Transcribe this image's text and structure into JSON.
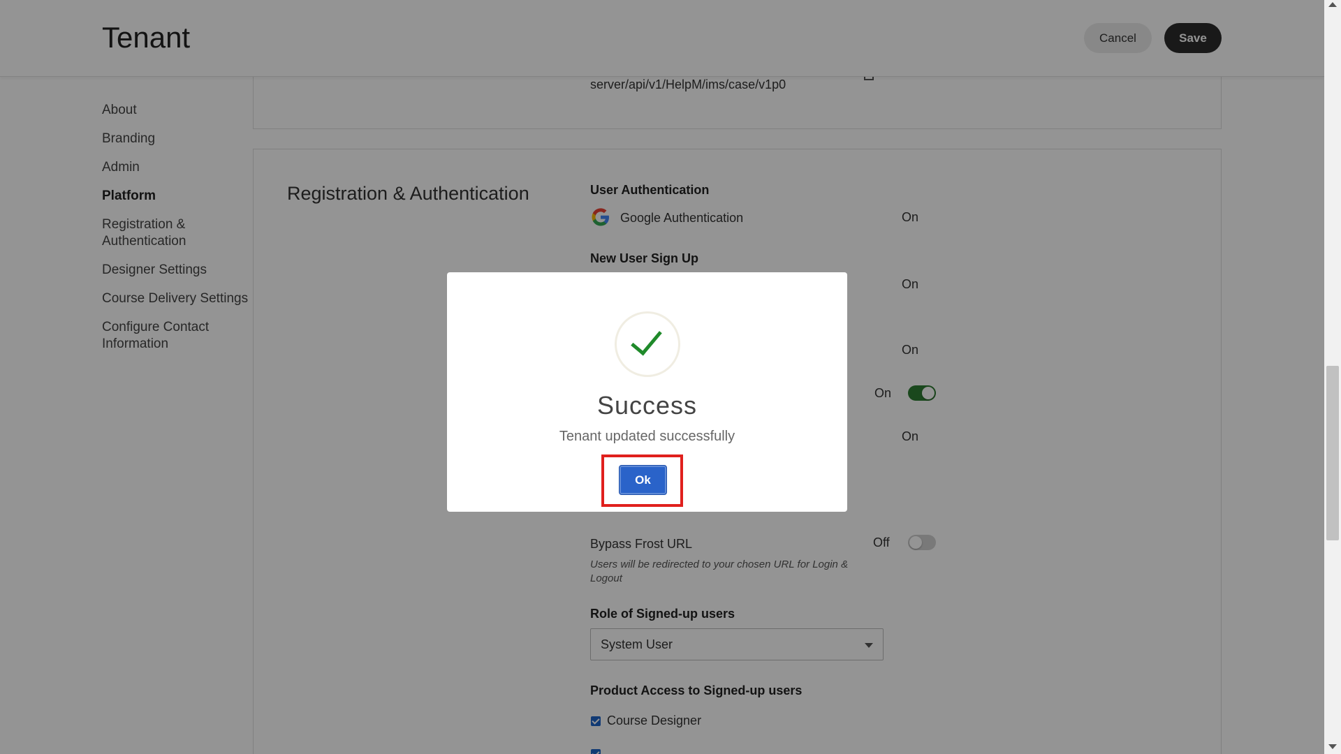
{
  "header": {
    "title": "Tenant",
    "cancel_label": "Cancel",
    "save_label": "Save"
  },
  "nav": {
    "items": [
      {
        "label": "About"
      },
      {
        "label": "Branding"
      },
      {
        "label": "Admin"
      },
      {
        "label": "Platform"
      },
      {
        "label": "Registration & Authentication"
      },
      {
        "label": "Designer Settings"
      },
      {
        "label": "Course Delivery Settings"
      },
      {
        "label": "Configure Contact Information"
      }
    ]
  },
  "content": {
    "url_value": "server/api/v1/HelpM/ims/case/v1p0",
    "section_title": "Registration & Authentication",
    "user_auth_heading": "User Authentication",
    "google_auth_label": "Google Authentication",
    "google_auth_state": "On",
    "new_user_heading": "New User Sign Up",
    "state_on_1": "On",
    "state_on_2": "On",
    "state_on_3": "On",
    "state_on_4": "On",
    "bypass_label": "Bypass Frost URL",
    "bypass_state": "Off",
    "bypass_hint": "Users will be redirected to your chosen URL for Login & Logout",
    "role_heading": "Role of Signed-up users",
    "role_value": "System User",
    "product_heading": "Product Access to Signed-up users",
    "product_course_designer": "Course Designer"
  },
  "modal": {
    "title": "Success",
    "message": "Tenant updated successfully",
    "ok_label": "Ok"
  },
  "colors": {
    "accent_blue": "#2a63c9",
    "success_green": "#1f8a2a",
    "highlight_red": "#e0201d",
    "toggle_on": "#2e7d32"
  }
}
